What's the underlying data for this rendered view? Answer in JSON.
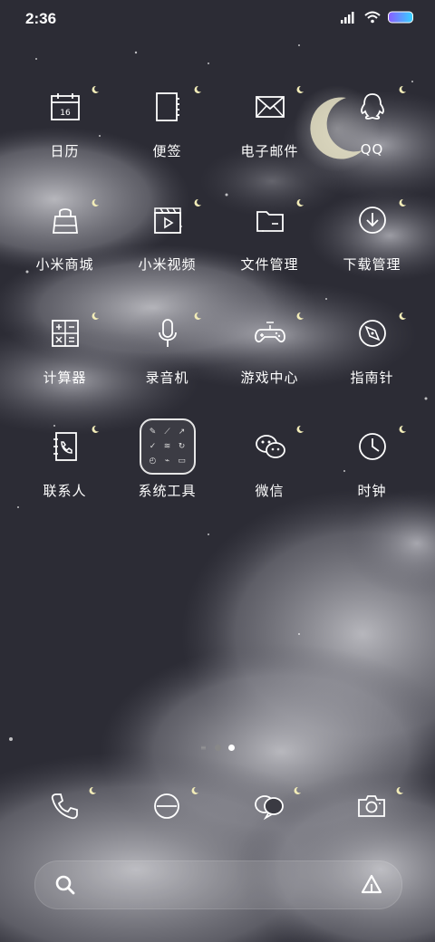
{
  "status_bar": {
    "time": "2:36"
  },
  "apps": [
    {
      "label": "日历",
      "icon": "calendar-icon",
      "date": "16"
    },
    {
      "label": "便签",
      "icon": "notes-icon"
    },
    {
      "label": "电子邮件",
      "icon": "mail-icon"
    },
    {
      "label": "QQ",
      "icon": "qq-icon"
    },
    {
      "label": "小米商城",
      "icon": "shopping-bag-icon"
    },
    {
      "label": "小米视频",
      "icon": "video-icon"
    },
    {
      "label": "文件管理",
      "icon": "folder-icon"
    },
    {
      "label": "下载管理",
      "icon": "download-icon"
    },
    {
      "label": "计算器",
      "icon": "calculator-icon"
    },
    {
      "label": "录音机",
      "icon": "microphone-icon"
    },
    {
      "label": "游戏中心",
      "icon": "gamepad-icon"
    },
    {
      "label": "指南针",
      "icon": "compass-icon"
    },
    {
      "label": "联系人",
      "icon": "contacts-icon"
    },
    {
      "label": "系统工具",
      "icon": "folder-tools-icon"
    },
    {
      "label": "微信",
      "icon": "wechat-icon"
    },
    {
      "label": "时钟",
      "icon": "clock-icon"
    }
  ],
  "dock": [
    {
      "icon": "phone-icon"
    },
    {
      "icon": "browser-icon"
    },
    {
      "icon": "messages-icon"
    },
    {
      "icon": "camera-icon"
    }
  ],
  "page_indicator": {
    "pages": 2,
    "current": 2
  },
  "search_bar": {
    "left_icon": "search-icon",
    "right_icon": "assistant-icon"
  }
}
